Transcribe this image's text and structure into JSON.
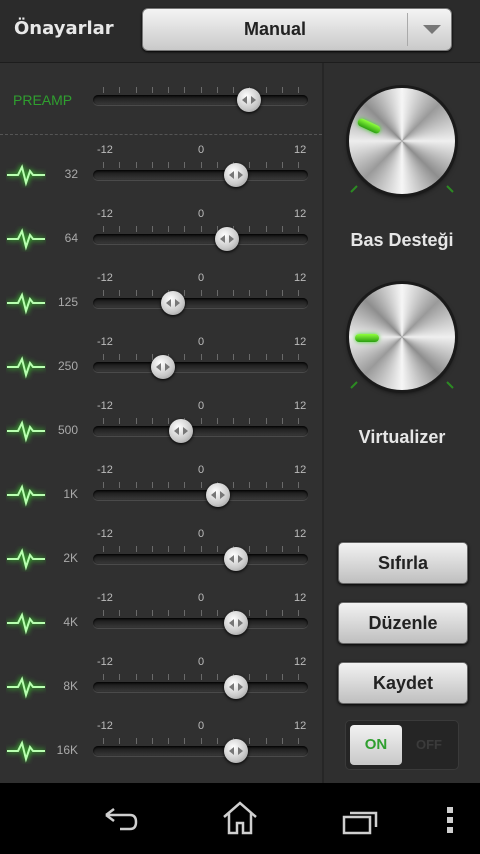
{
  "header": {
    "presets_label": "Önayarlar",
    "preset_value": "Manual"
  },
  "preamp": {
    "label": "PREAMP",
    "value_fraction": 0.75
  },
  "scale": {
    "min": "-12",
    "mid": "0",
    "max": "12"
  },
  "bands": [
    {
      "label": "32",
      "value": 4.4
    },
    {
      "label": "64",
      "value": 3.2
    },
    {
      "label": "125",
      "value": -3.4
    },
    {
      "label": "250",
      "value": -4.6
    },
    {
      "label": "500",
      "value": -2.4
    },
    {
      "label": "1K",
      "value": 2.2
    },
    {
      "label": "2K",
      "value": 4.4
    },
    {
      "label": "4K",
      "value": 4.4
    },
    {
      "label": "8K",
      "value": 4.4
    },
    {
      "label": "16K",
      "value": 4.4
    }
  ],
  "bass": {
    "label": "Bas Desteği"
  },
  "virtualizer": {
    "label": "Virtualizer"
  },
  "buttons": {
    "reset": "Sıfırla",
    "edit": "Düzenle",
    "save": "Kaydet"
  },
  "toggle": {
    "on": "ON",
    "off": "OFF",
    "state": "ON"
  },
  "navbar": {
    "icons": [
      "back-icon",
      "home-icon",
      "recent-apps-icon",
      "menu-icon"
    ]
  },
  "colors": {
    "accent_green": "#2f9f2f",
    "glow_green": "#5cff3c"
  }
}
